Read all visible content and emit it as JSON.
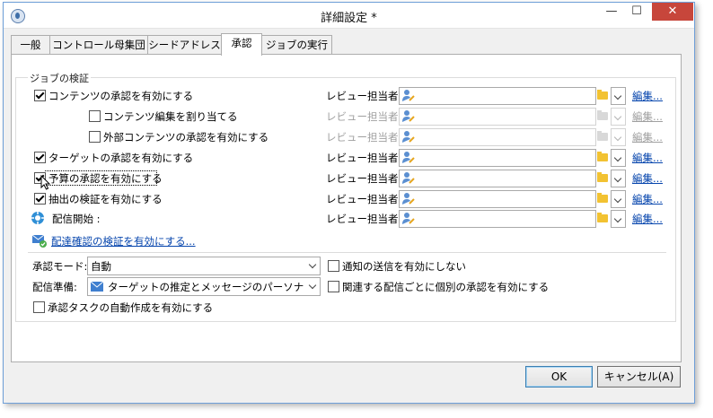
{
  "window": {
    "title": "詳細設定 *"
  },
  "tabs": [
    {
      "label": "一般"
    },
    {
      "label": "コントロール母集団"
    },
    {
      "label": "シードアドレス"
    },
    {
      "label": "承認"
    },
    {
      "label": "ジョブの実行"
    }
  ],
  "active_tab": "承認",
  "job_validation": {
    "group_title": "ジョブの検証",
    "reviewer_label": "レビュー担当者:",
    "edit_label": "編集...",
    "rows": [
      {
        "label": "コンテンツの承認を有効にする",
        "checked": true,
        "enabled": true
      },
      {
        "label": "コンテンツ編集を割り当てる",
        "checked": false,
        "enabled": false
      },
      {
        "label": "外部コンテンツの承認を有効にする",
        "checked": false,
        "enabled": false
      },
      {
        "label": "ターゲットの承認を有効にする",
        "checked": true,
        "enabled": true
      },
      {
        "label": "予算の承認を有効にする",
        "checked": true,
        "enabled": true
      },
      {
        "label": "抽出の検証を有効にする",
        "checked": true,
        "enabled": true
      },
      {
        "label": "配信開始 :",
        "checked": null,
        "enabled": true
      }
    ],
    "proof_link": "配達確認の検証を有効にする..."
  },
  "approval_mode": {
    "label": "承認モード:",
    "value": "自動",
    "notify_label": "通知の送信を有効にしない",
    "notify_checked": false
  },
  "delivery_prep": {
    "label": "配信準備:",
    "value": "ターゲットの推定とメッセージのパーソナライゼーション",
    "individual_label": "関連する配信ごとに個別の承認を有効にする",
    "individual_checked": false
  },
  "auto_task": {
    "label": "承認タスクの自動作成を有効にする",
    "checked": false
  },
  "buttons": {
    "ok": "OK",
    "cancel": "キャンセル(A)"
  },
  "colors": {
    "link": "#0645ad",
    "close_button": "#c7463b",
    "folder": "#f2c232"
  }
}
